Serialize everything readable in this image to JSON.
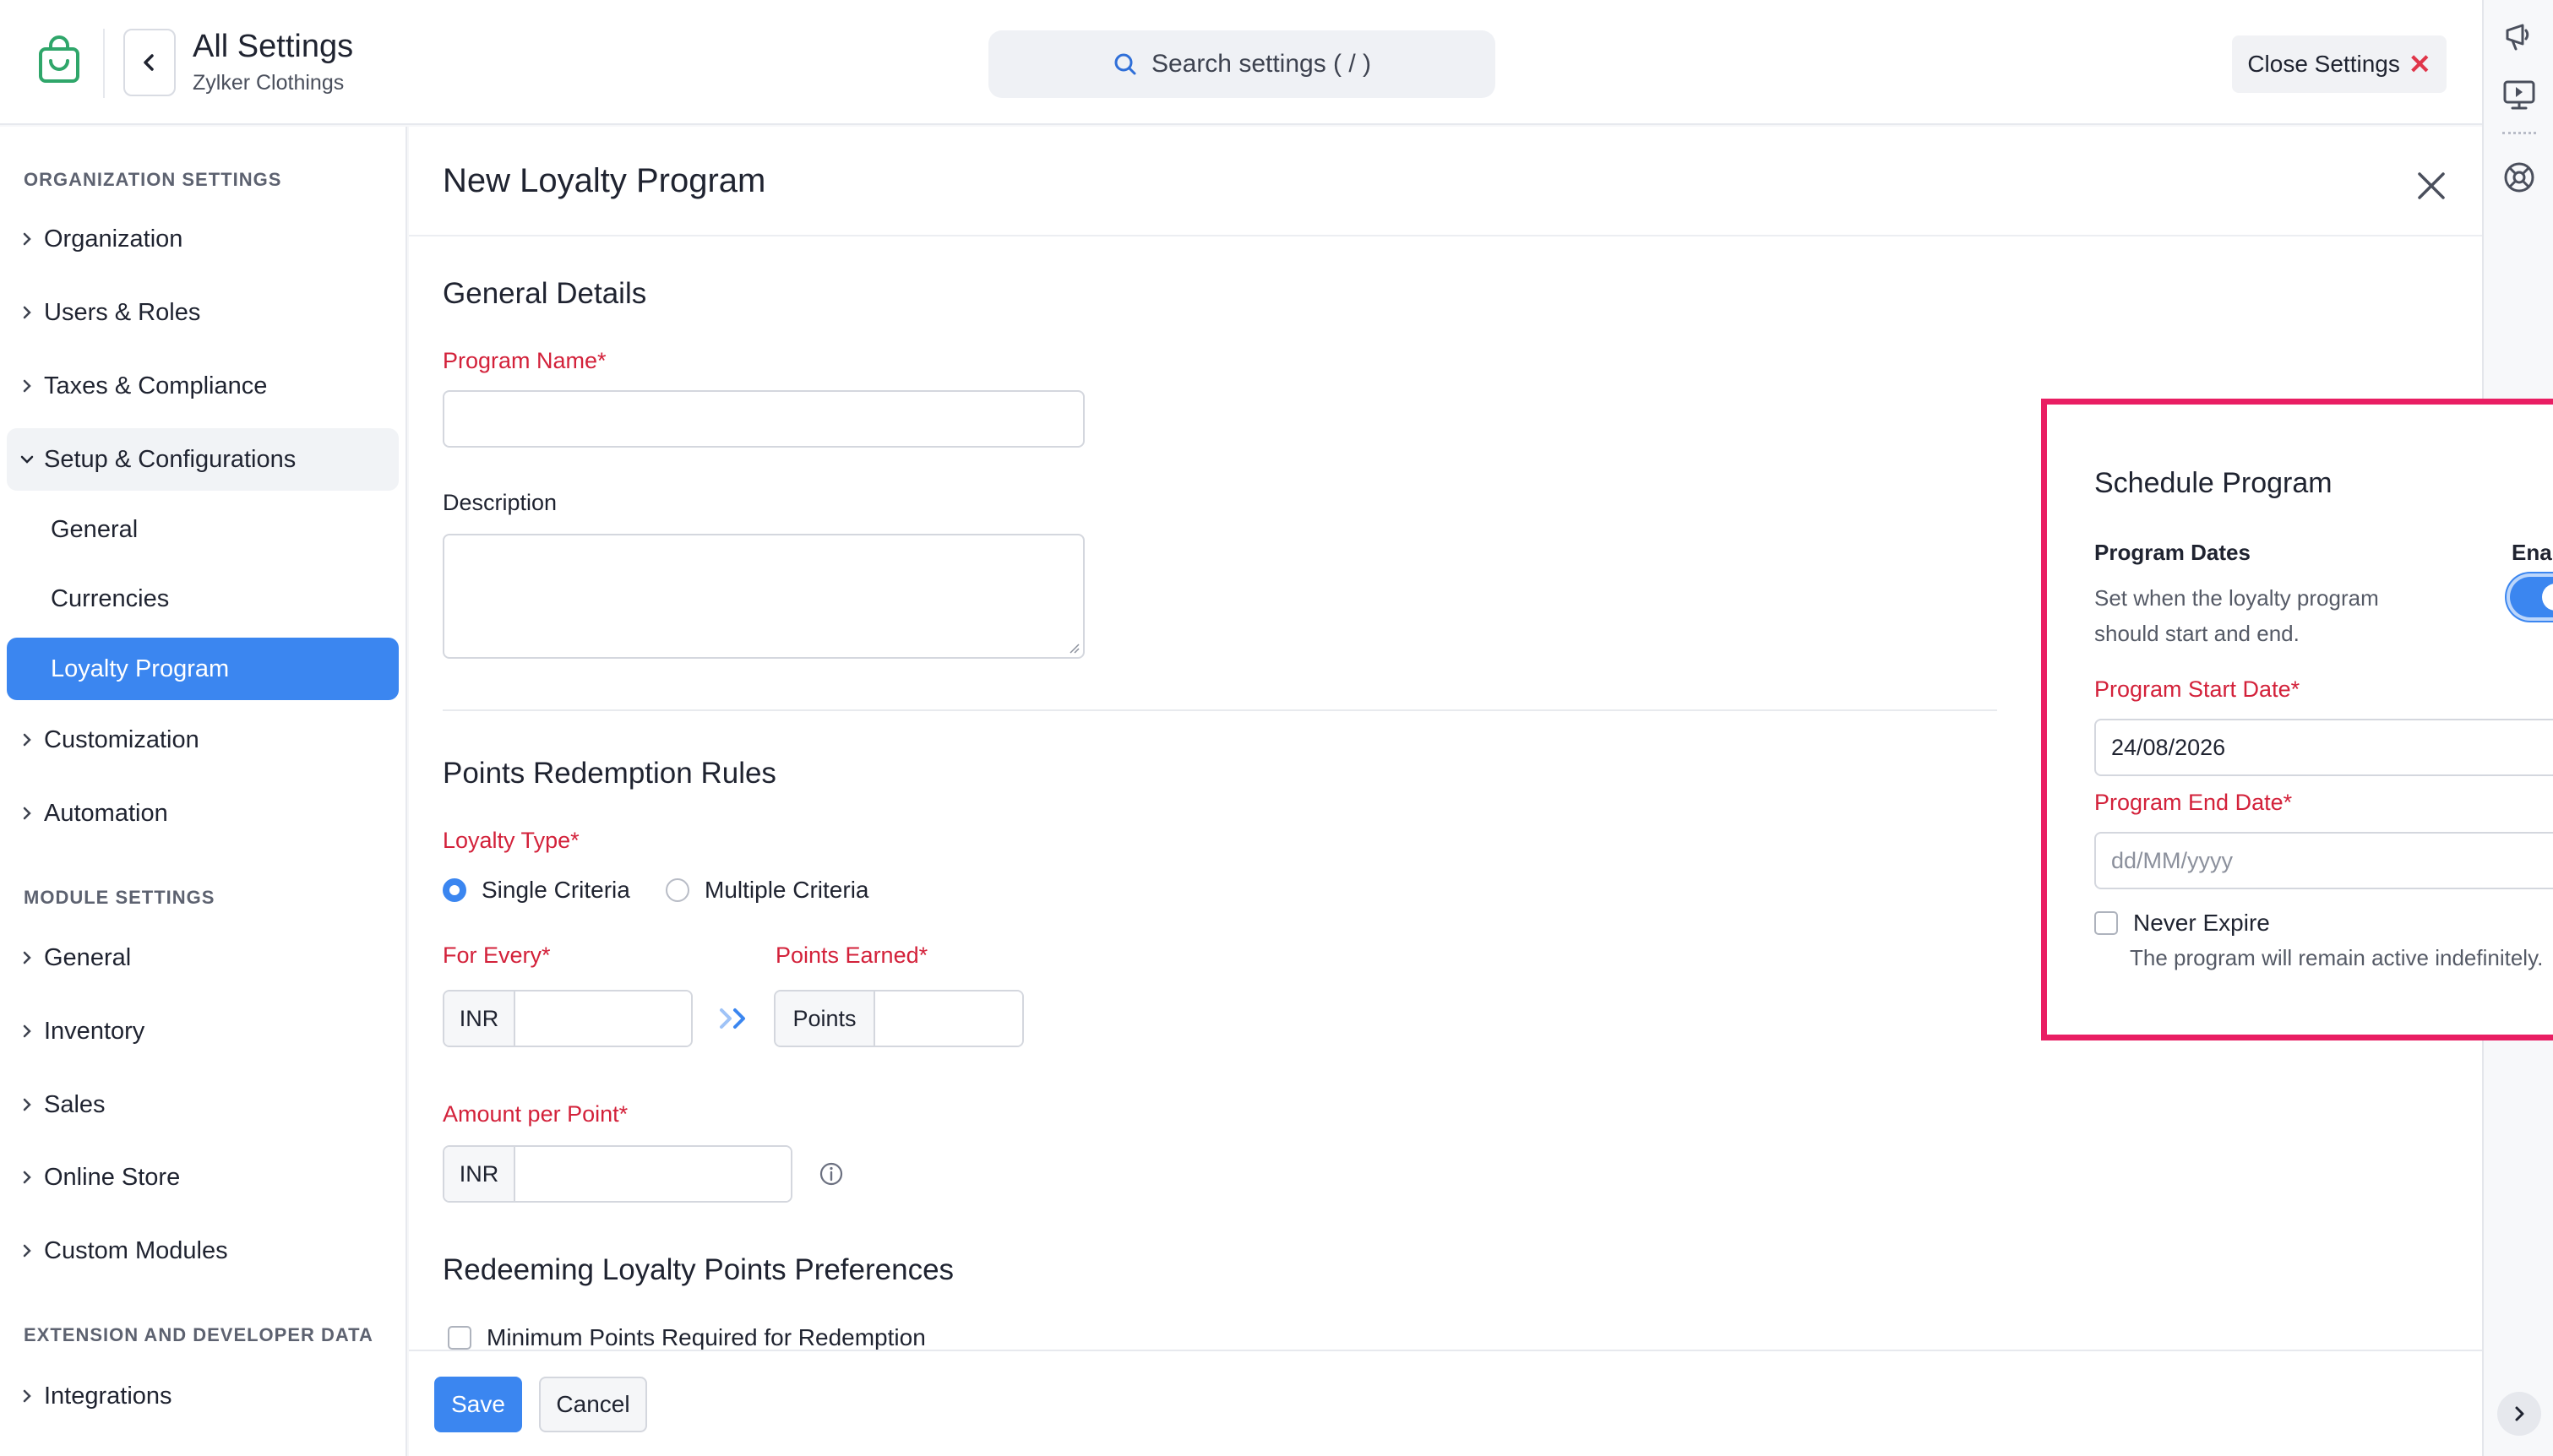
{
  "header": {
    "title": "All Settings",
    "org_name": "Zylker Clothings",
    "search_placeholder": "Search settings ( / )",
    "close_label": "Close Settings",
    "close_symbol": "✕",
    "logo_icon": "shopping-bag-icon",
    "back_icon": "chevron-left-icon"
  },
  "sidebar": {
    "org_section": "ORGANIZATION SETTINGS",
    "org_items": [
      "Organization",
      "Users & Roles",
      "Taxes & Compliance"
    ],
    "setup": {
      "label": "Setup & Configurations",
      "children": [
        "General",
        "Currencies",
        "Loyalty Program"
      ]
    },
    "org_items_after": [
      "Customization",
      "Automation"
    ],
    "module_section": "MODULE SETTINGS",
    "module_items": [
      "General",
      "Inventory",
      "Sales",
      "Online Store",
      "Custom Modules"
    ],
    "ext_section": "EXTENSION AND DEVELOPER DATA",
    "ext_items": [
      "Integrations"
    ],
    "active_item": "Loyalty Program",
    "accent": "#3b86f0"
  },
  "main": {
    "title": "New Loyalty Program",
    "general": {
      "heading": "General Details",
      "program_name_label": "Program Name*",
      "program_name_value": "",
      "description_label": "Description",
      "description_value": ""
    },
    "redemption": {
      "heading": "Points Redemption Rules",
      "loyalty_type_label": "Loyalty Type*",
      "options": [
        "Single Criteria",
        "Multiple Criteria"
      ],
      "selected": "Single Criteria",
      "for_every_label": "For Every*",
      "for_every_addon": "INR",
      "points_earned_label": "Points Earned*",
      "points_addon": "Points",
      "amount_per_point_label": "Amount per Point*",
      "amount_addon": "INR"
    },
    "preferences": {
      "heading": "Redeeming Loyalty Points Preferences",
      "min_points_label": "Minimum Points Required for Redemption",
      "min_points_checked": false
    }
  },
  "schedule": {
    "title": "Schedule Program",
    "program_dates_label": "Program Dates",
    "enabled_label": "Enabled",
    "enabled": true,
    "description": "Set when the loyalty program should start and end.",
    "start_date_label": "Program Start Date*",
    "start_date_value": "24/08/2026",
    "end_date_label": "Program End Date*",
    "end_date_placeholder": "dd/MM/yyyy",
    "never_expire_label": "Never Expire",
    "never_expire_desc": "The program will remain active indefinitely.",
    "never_expire_checked": false,
    "highlight_color": "#e91e63"
  },
  "footer": {
    "save_label": "Save",
    "cancel_label": "Cancel"
  },
  "rail": {
    "icons": [
      "whats-new-icon",
      "video-tutorial-icon",
      "help-icon",
      "expand-icon"
    ]
  },
  "colors": {
    "required": "#d3213a",
    "primary": "#3b86f0"
  }
}
